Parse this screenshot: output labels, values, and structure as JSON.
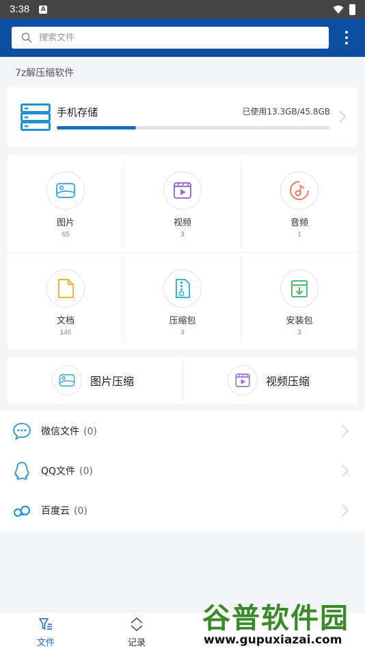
{
  "status_bar": {
    "time": "3:38",
    "notification_letter": "A"
  },
  "header": {
    "search_placeholder": "搜索文件"
  },
  "app_title": "7z解压缩软件",
  "storage": {
    "label": "手机存储",
    "used_text": "已使用13.3GB/45.8GB",
    "used_fraction": 0.29
  },
  "categories": [
    {
      "label": "图片",
      "count": "65",
      "icon": "image-icon",
      "color": "#4aa8e0"
    },
    {
      "label": "视频",
      "count": "3",
      "icon": "video-icon",
      "color": "#9a6ad6"
    },
    {
      "label": "音频",
      "count": "1",
      "icon": "audio-icon",
      "color": "#ee7a5a"
    },
    {
      "label": "文档",
      "count": "146",
      "icon": "document-icon",
      "color": "#f0b43a"
    },
    {
      "label": "压缩包",
      "count": "4",
      "icon": "archive-icon",
      "color": "#35b8e0"
    },
    {
      "label": "安装包",
      "count": "3",
      "icon": "install-package-icon",
      "color": "#4bbd6a"
    }
  ],
  "compress": [
    {
      "label": "图片压缩",
      "icon": "image-icon"
    },
    {
      "label": "视频压缩",
      "icon": "video-icon"
    }
  ],
  "sources": [
    {
      "label": "微信文件",
      "count": "(0)",
      "icon": "wechat-icon"
    },
    {
      "label": "QQ文件",
      "count": "(0)",
      "icon": "qq-icon"
    },
    {
      "label": "百度云",
      "count": "(0)",
      "icon": "baidu-cloud-icon"
    }
  ],
  "bottom_nav": [
    {
      "label": "文件",
      "icon": "files-icon",
      "active": true
    },
    {
      "label": "记录",
      "icon": "records-icon",
      "active": false
    }
  ],
  "watermark": {
    "title": "谷普软件园",
    "url": "www.gupuxiazai.com"
  },
  "colors": {
    "header_bg": "#0b4ea2",
    "accent": "#1e6ac8",
    "active_nav": "#1e6ac8"
  }
}
